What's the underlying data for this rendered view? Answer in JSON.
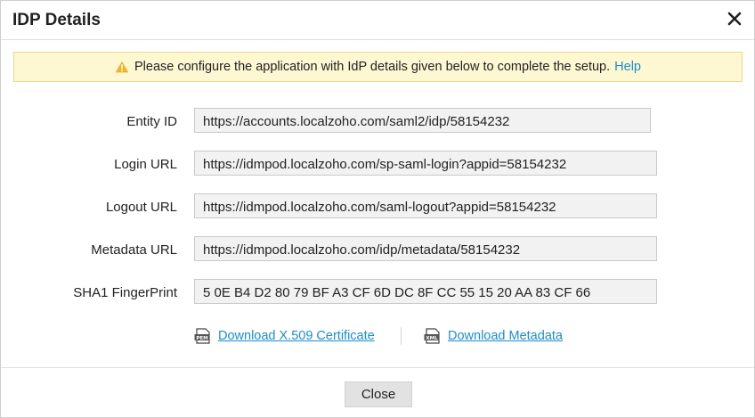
{
  "dialog": {
    "title": "IDP Details",
    "close_icon": "close-icon"
  },
  "banner": {
    "message": "Please configure the application with IdP details given below to complete the setup.",
    "help_link": "Help",
    "icon": "warning-icon",
    "bg_color": "#fdf7d2"
  },
  "fields": [
    {
      "label": "Entity ID",
      "value": "https://accounts.localzoho.com/saml2/idp/58154232"
    },
    {
      "label": "Login URL",
      "value": "https://idmpod.localzoho.com/sp-saml-login?appid=58154232"
    },
    {
      "label": "Logout URL",
      "value": "https://idmpod.localzoho.com/saml-logout?appid=58154232"
    },
    {
      "label": "Metadata URL",
      "value": "https://idmpod.localzoho.com/idp/metadata/58154232"
    },
    {
      "label": "SHA1 FingerPrint",
      "value": "5 0E B4 D2 80 79 BF A3 CF 6D DC 8F CC 55 15 20 AA 83 CF 66"
    }
  ],
  "downloads": {
    "certificate": {
      "label": "Download X.509 Certificate",
      "icon": "pem-file-icon"
    },
    "metadata": {
      "label": "Download Metadata",
      "icon": "xml-file-icon"
    }
  },
  "footer": {
    "close_label": "Close"
  },
  "colors": {
    "link": "#1a8ed0",
    "field_bg": "#f2f2f2"
  }
}
